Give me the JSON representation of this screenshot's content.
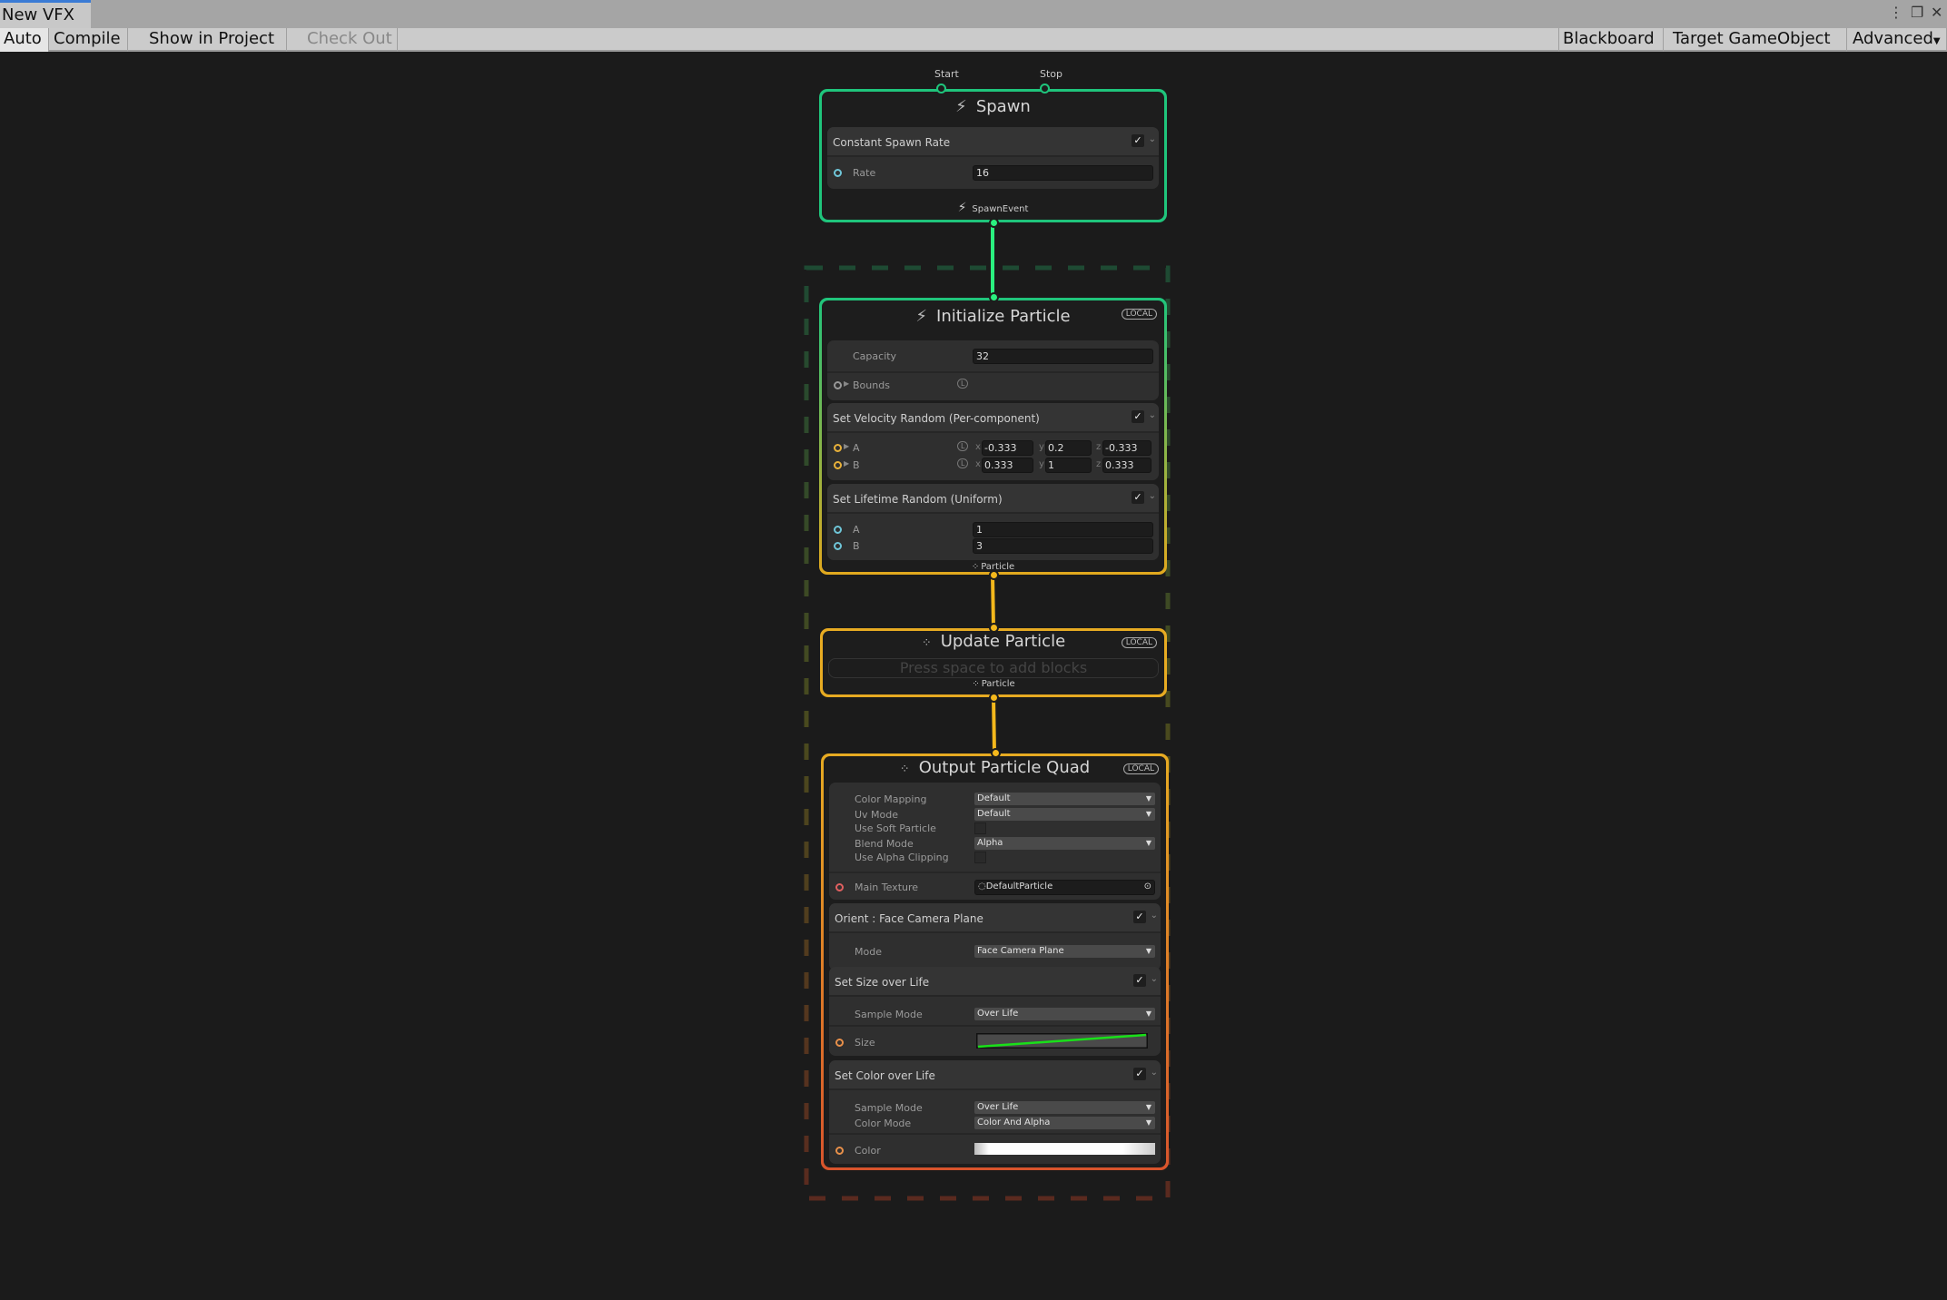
{
  "window": {
    "tab": "New VFX"
  },
  "toolbar": {
    "auto": "Auto",
    "compile": "Compile",
    "show_in_project": "Show in Project",
    "check_out": "Check Out",
    "blackboard": "Blackboard",
    "target": "Target GameObject",
    "advanced": "Advanced"
  },
  "colors": {
    "spawn": "#1fc57c",
    "init_bottom": "#e2a91e",
    "update": "#e7ab22",
    "output_bottom": "#d8542c"
  },
  "spawn": {
    "title": "Spawn",
    "start": "Start",
    "stop": "Stop",
    "block": "Constant Spawn Rate",
    "rate_label": "Rate",
    "rate": "16",
    "event": "SpawnEvent"
  },
  "init": {
    "title": "Initialize Particle",
    "space": "LOCAL",
    "capacity_label": "Capacity",
    "capacity": "32",
    "bounds_label": "Bounds",
    "lock": "L",
    "velocity": {
      "title": "Set Velocity Random (Per-component)",
      "a_label": "A",
      "b_label": "B",
      "a": {
        "x": "-0.333",
        "y": "0.2",
        "z": "-0.333"
      },
      "b": {
        "x": "0.333",
        "y": "1",
        "z": "0.333"
      }
    },
    "lifetime": {
      "title": "Set Lifetime Random (Uniform)",
      "a_label": "A",
      "a": "1",
      "b_label": "B",
      "b": "3"
    },
    "out": "Particle"
  },
  "update": {
    "title": "Update Particle",
    "space": "LOCAL",
    "placeholder": "Press space to add blocks",
    "out": "Particle"
  },
  "output": {
    "title": "Output Particle Quad",
    "space": "LOCAL",
    "color_mapping_label": "Color Mapping",
    "color_mapping": "Default",
    "uv_mode_label": "Uv Mode",
    "uv_mode": "Default",
    "soft_particle_label": "Use Soft Particle",
    "blend_mode_label": "Blend Mode",
    "blend_mode": "Alpha",
    "alpha_clip_label": "Use Alpha Clipping",
    "main_texture_label": "Main Texture",
    "main_texture": "DefaultParticle",
    "orient": {
      "title": "Orient : Face Camera Plane",
      "mode_label": "Mode",
      "mode": "Face Camera Plane"
    },
    "size": {
      "title": "Set Size over Life",
      "sample_label": "Sample Mode",
      "sample": "Over Life",
      "size_label": "Size"
    },
    "color": {
      "title": "Set Color over Life",
      "sample_label": "Sample Mode",
      "sample": "Over Life",
      "mode_label": "Color Mode",
      "mode": "Color And Alpha",
      "color_label": "Color"
    }
  }
}
